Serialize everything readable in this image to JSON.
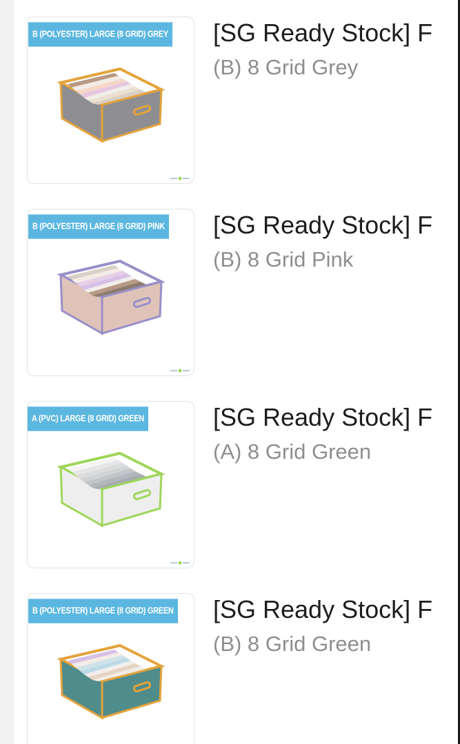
{
  "items": [
    {
      "thumb_label": "B (POLYESTER) LARGE (8 GRID) GREY",
      "title": "[SG Ready Stock] F",
      "variant": "(B) 8 Grid Grey",
      "box_color": "#8e8e92",
      "trim_color": "#e3a33c"
    },
    {
      "thumb_label": "B (POLYESTER) LARGE (8 GRID) PINK",
      "title": "[SG Ready Stock] F",
      "variant": "(B) 8 Grid Pink",
      "box_color": "#e0c3b8",
      "trim_color": "#9a8fc9"
    },
    {
      "thumb_label": "A (PVC) LARGE (8 GRID) GREEN",
      "title": "[SG Ready Stock] F",
      "variant": "(A) 8 Grid Green",
      "box_color": "#eeeeee",
      "trim_color": "#9fd65a"
    },
    {
      "thumb_label": "B (POLYESTER) LARGE (8 GRID) GREEN",
      "title": "[SG Ready Stock] F",
      "variant": "(B) 8 Grid Green",
      "box_color": "#4f8c8a",
      "trim_color": "#e3a33c"
    }
  ],
  "colors": {
    "label_bg": "#5bb7e0",
    "title_text": "#1d1d1d",
    "variant_text": "#8e8e8e"
  },
  "icons": [
    "product-thumbnail-image",
    "storage-box-illustration"
  ]
}
